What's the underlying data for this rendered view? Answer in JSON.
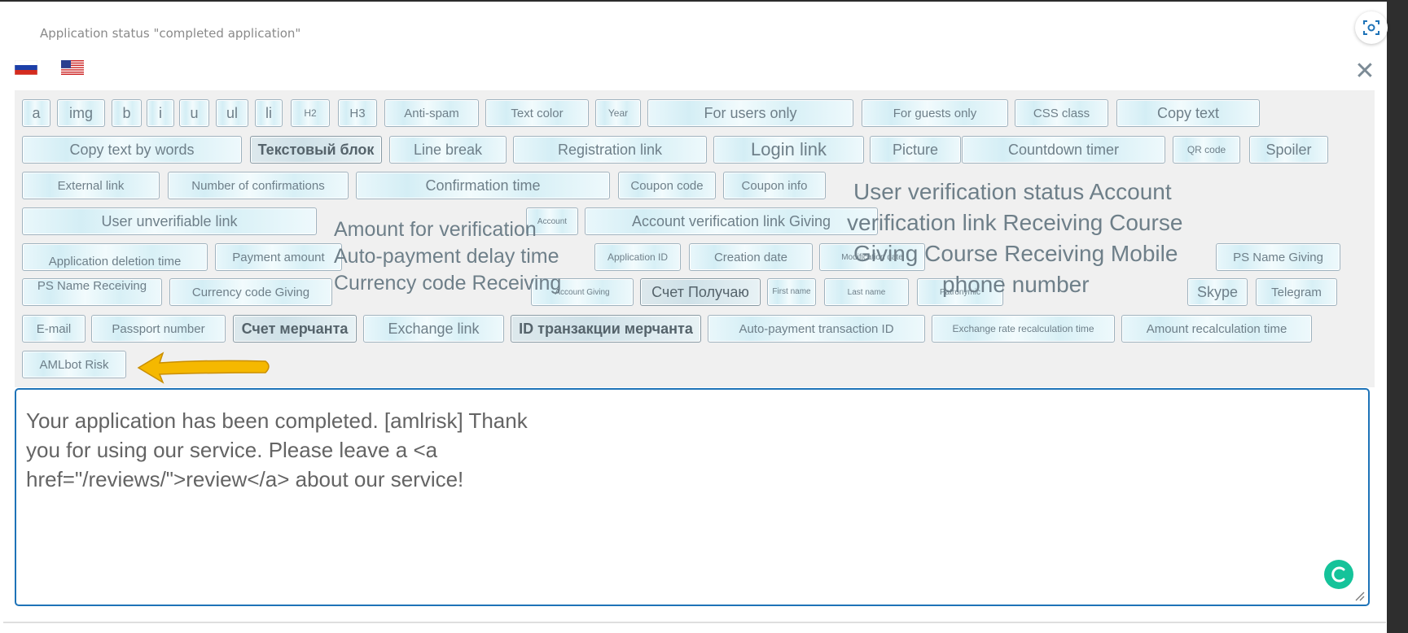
{
  "window": {
    "title": "Application status \"completed application\""
  },
  "languages": [
    {
      "code": "ru",
      "icon": "russia-flag-icon"
    },
    {
      "code": "en",
      "icon": "usa-flag-icon"
    }
  ],
  "toolbar": {
    "buttons": [
      "a",
      "img",
      "b",
      "i",
      "u",
      "ul",
      "li",
      "H2",
      "H3",
      "Anti-spam",
      "Text color",
      "Year",
      "For users only",
      "For guests only",
      "CSS class",
      "Copy text",
      "Copy text by words",
      "Текстовый блок",
      "Line break",
      "Registration link",
      "Login link",
      "Picture",
      "Countdown timer",
      "QR code",
      "Spoiler",
      "External link",
      "Number of confirmations",
      "Confirmation time",
      "Coupon code",
      "Coupon info",
      "User unverifiable link",
      "Account",
      "Account verification link Giving",
      "Application deletion time",
      "Payment amount",
      "Application ID",
      "Creation date",
      "Modification date",
      "PS Name Giving",
      "PS Name Receiving",
      "Currency code Giving",
      "Account Giving",
      "Счет Получаю",
      "First name",
      "Last name",
      "Patronymic",
      "Skype",
      "Telegram",
      "E-mail",
      "Passport number",
      "Счет мерчанта",
      "Exchange link",
      "ID транзакции мерчанта",
      "Auto-payment transaction ID",
      "Exchange rate recalculation time",
      "Amount recalculation time",
      "AMLbot Risk"
    ],
    "overflow_texts": [
      "User verification status Account",
      "verification link Receiving Course",
      "Giving Course Receiving Mobile",
      "phone number",
      "Amount for verification",
      "Auto-payment delay time",
      "Currency code Receiving"
    ]
  },
  "editor": {
    "lines": [
      "Your application has been completed. [amlrisk] Thank",
      "you for using our service. Please leave a <a",
      "href=\"/reviews/\">review</a> about our service!"
    ]
  },
  "colors": {
    "accent": "#1e73b8",
    "arrow": "#f5b800",
    "grammar": "#15c39a"
  }
}
